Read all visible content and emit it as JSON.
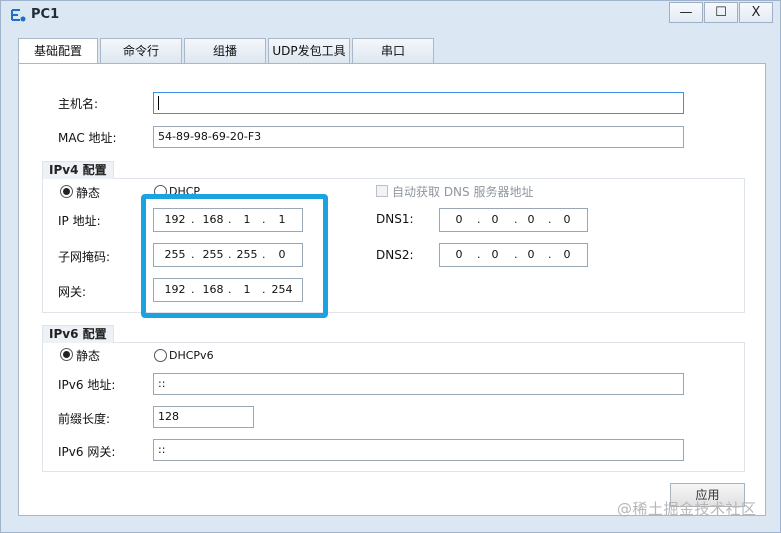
{
  "window": {
    "title": "PC1",
    "controls": {
      "minimize": "—",
      "maximize": "☐",
      "close": "X"
    }
  },
  "tabs": [
    {
      "label": "基础配置",
      "active": true
    },
    {
      "label": "命令行",
      "active": false
    },
    {
      "label": "组播",
      "active": false
    },
    {
      "label": "UDP发包工具",
      "active": false
    },
    {
      "label": "串口",
      "active": false
    }
  ],
  "basic": {
    "hostname_label": "主机名:",
    "hostname_value": "",
    "mac_label": "MAC 地址:",
    "mac_value": "54-89-98-69-20-F3"
  },
  "ipv4": {
    "section_title": "IPv4 配置",
    "static_label": "静态",
    "dhcp_label": "DHCP",
    "mode": "static",
    "auto_dns_label": "自动获取 DNS 服务器地址",
    "auto_dns_checked": false,
    "ip_label": "IP 地址:",
    "ip": [
      "192",
      "168",
      "1",
      "1"
    ],
    "mask_label": "子网掩码:",
    "mask": [
      "255",
      "255",
      "255",
      "0"
    ],
    "gateway_label": "网关:",
    "gateway": [
      "192",
      "168",
      "1",
      "254"
    ],
    "dns1_label": "DNS1:",
    "dns1": [
      "0",
      "0",
      "0",
      "0"
    ],
    "dns2_label": "DNS2:",
    "dns2": [
      "0",
      "0",
      "0",
      "0"
    ],
    "highlight_color": "#1aa3e0"
  },
  "ipv6": {
    "section_title": "IPv6 配置",
    "static_label": "静态",
    "dhcp_label": "DHCPv6",
    "mode": "static",
    "addr_label": "IPv6 地址:",
    "addr_value": "::",
    "prefix_label": "前缀长度:",
    "prefix_value": "128",
    "gateway_label": "IPv6 网关:",
    "gateway_value": "::"
  },
  "footer": {
    "apply_label": "应用",
    "watermark": "@稀土掘金技术社区"
  }
}
